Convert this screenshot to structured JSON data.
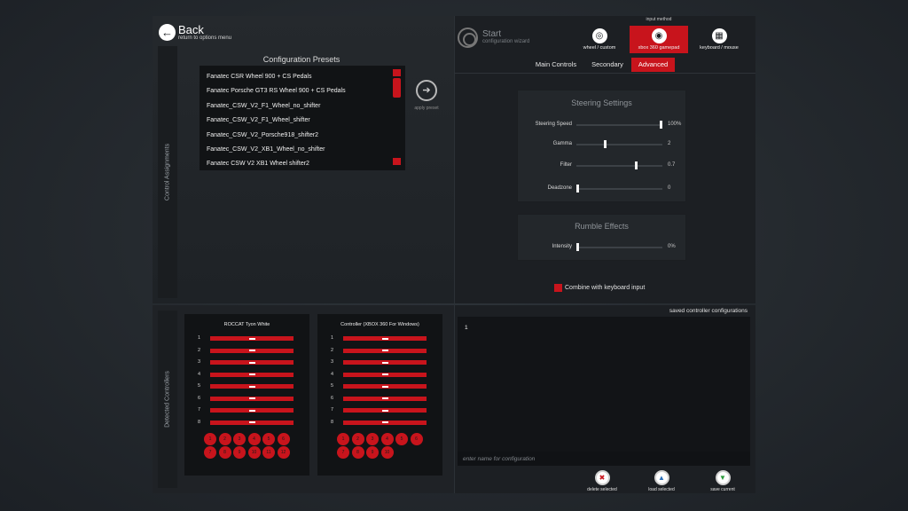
{
  "back": {
    "label": "Back",
    "sub": "return to options menu"
  },
  "side_tabs": {
    "control_assignments": "Control Assignments",
    "detected_controllers": "Detected Controllers"
  },
  "presets": {
    "title": "Configuration Presets",
    "items": [
      "Fanatec CSR Wheel 900 + CS Pedals",
      "Fanatec Porsche GT3 RS Wheel 900 + CS Pedals",
      "Fanatec_CSW_V2_F1_Wheel_no_shifter",
      "Fanatec_CSW_V2_F1_Wheel_shifter",
      "Fanatec_CSW_V2_Porsche918_shifter2",
      "Fanatec_CSW_V2_XB1_Wheel_no_shifter",
      "Fanatec CSW V2 XB1 Wheel shifter2"
    ],
    "apply_label": "apply preset"
  },
  "start": {
    "label": "Start",
    "sub": "configuration wizard"
  },
  "input_method": {
    "title": "input method",
    "options": [
      {
        "label": "wheel / custom",
        "icon": "steering-wheel-icon",
        "glyph": "◎"
      },
      {
        "label": "xbox 360 gamepad",
        "icon": "gamepad-icon",
        "glyph": "◉"
      },
      {
        "label": "keyboard / mouse",
        "icon": "keyboard-icon",
        "glyph": "▦"
      }
    ],
    "selected": "xbox 360 gamepad"
  },
  "tabs": [
    "Main Controls",
    "Secondary",
    "Advanced"
  ],
  "active_tab": "Advanced",
  "steering": {
    "title": "Steering Settings",
    "sliders": [
      {
        "label": "Steering Speed",
        "value": "100%",
        "level": 1.0
      },
      {
        "label": "Gamma",
        "value": "2",
        "level": 0.33
      },
      {
        "label": "Filter",
        "value": "0.7",
        "level": 0.7
      },
      {
        "label": "Deadzone",
        "value": "0",
        "level": 0.0
      }
    ]
  },
  "rumble": {
    "title": "Rumble Effects",
    "sliders": [
      {
        "label": "Intensity",
        "value": "0%",
        "level": 0.0
      }
    ]
  },
  "combine_label": "Combine with keyboard input",
  "controllers": [
    {
      "name": "ROCCAT Tyon White",
      "axes": [
        "1",
        "2",
        "3",
        "4",
        "5",
        "6",
        "7",
        "8"
      ],
      "buttons": [
        "1",
        "2",
        "3",
        "4",
        "5",
        "6",
        "7",
        "8",
        "9",
        "10",
        "11",
        "12"
      ]
    },
    {
      "name": "Controller (XBOX 360 For Windows)",
      "axes": [
        "1",
        "2",
        "3",
        "4",
        "5",
        "6",
        "7",
        "8"
      ],
      "buttons": [
        "1",
        "2",
        "3",
        "4",
        "5",
        "6",
        "7",
        "8",
        "9",
        "10"
      ]
    }
  ],
  "saved": {
    "title": "saved controller configurations",
    "items": [
      "1"
    ],
    "input_placeholder": "enter name for configuration"
  },
  "actions": {
    "delete": "delete selected",
    "load": "load selected",
    "save": "save current"
  },
  "colors": {
    "accent": "#c8141c",
    "background": "#1f2327"
  }
}
